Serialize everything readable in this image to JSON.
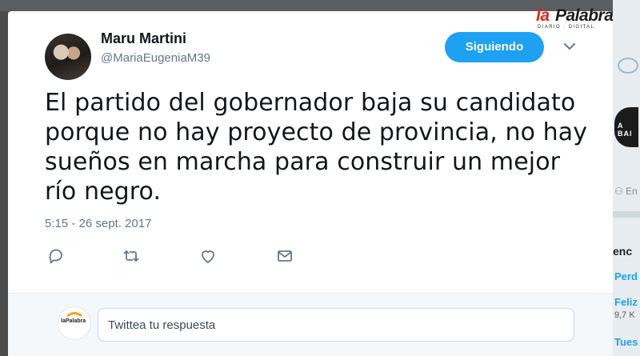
{
  "sidebar_peek": {
    "brand_badge": "A BAI",
    "reply_count_fragment": "En",
    "trends_heading": "enc",
    "trends": [
      {
        "label": "Perd",
        "sub": ""
      },
      {
        "label": "Feliz",
        "sub": "9,7 K"
      },
      {
        "label": "Tues",
        "sub": ""
      }
    ]
  },
  "tweet": {
    "author_name": "Maru Martini",
    "author_handle": "@MariaEugeniaM39",
    "follow_label": "Siguiendo",
    "text": "El partido del gobernador baja su candidato porque no hay proyecto de provincia, no hay sueños en marcha para construir un mejor río negro.",
    "timestamp": "5:15 - 26 sept. 2017"
  },
  "actions": {
    "icons": [
      "reply-icon",
      "retweet-icon",
      "like-icon",
      "direct-message-icon"
    ]
  },
  "reply": {
    "placeholder": "Twittea tu respuesta",
    "avatar_label": "laPalabra"
  },
  "watermark": {
    "brand_a": "la",
    "brand_b": "Palabra",
    "tagline": "DIARIO · DIGITAL"
  },
  "colors": {
    "accent": "#1da1f2",
    "text": "#14171a",
    "muted": "#657786",
    "watermark_red": "#e2251b"
  }
}
